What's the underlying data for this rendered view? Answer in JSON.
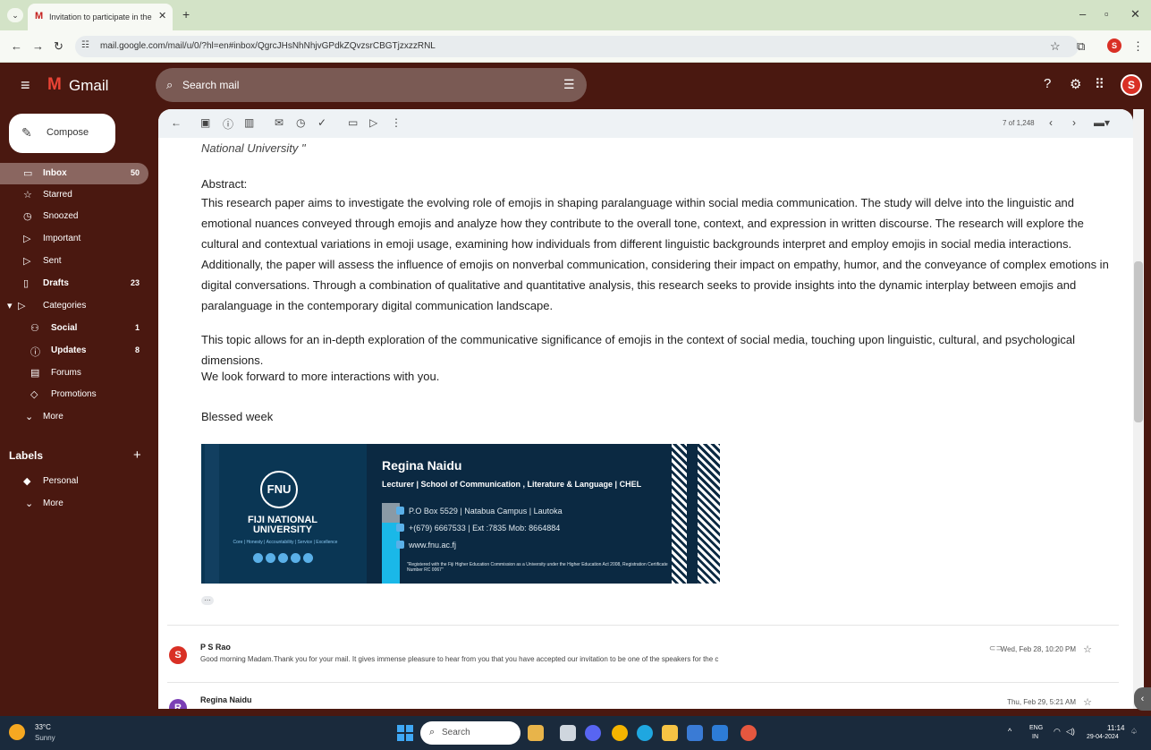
{
  "browser": {
    "tab_title": "Invitation to participate in the",
    "url": "mail.google.com/mail/u/0/?hl=en#inbox/QgrcJHsNhNhjvGPdkZQvzsrCBGTjzxzzRNL"
  },
  "gmail": {
    "app_name": "Gmail",
    "search_placeholder": "Search mail",
    "compose_label": "Compose",
    "nav": [
      {
        "label": "Inbox",
        "count": "50",
        "icon": "inbox-icon"
      },
      {
        "label": "Starred",
        "count": "",
        "icon": "star-icon"
      },
      {
        "label": "Snoozed",
        "count": "",
        "icon": "clock-icon"
      },
      {
        "label": "Important",
        "count": "",
        "icon": "important-icon"
      },
      {
        "label": "Sent",
        "count": "",
        "icon": "send-icon"
      },
      {
        "label": "Drafts",
        "count": "23",
        "icon": "draft-icon"
      },
      {
        "label": "Categories",
        "count": "",
        "icon": "label-icon"
      },
      {
        "label": "Social",
        "count": "1",
        "icon": "people-icon"
      },
      {
        "label": "Updates",
        "count": "8",
        "icon": "info-icon"
      },
      {
        "label": "Forums",
        "count": "",
        "icon": "forum-icon"
      },
      {
        "label": "Promotions",
        "count": "",
        "icon": "tag-icon"
      },
      {
        "label": "More",
        "count": "",
        "icon": "chevron-down-icon"
      }
    ],
    "labels_heading": "Labels",
    "labels": [
      {
        "label": "Personal"
      },
      {
        "label": "More"
      }
    ],
    "pager": "7 of 1,248"
  },
  "email": {
    "affiliation_line": "National University \"",
    "abstract_heading": "Abstract:",
    "abstract_body": "This research paper aims to investigate the evolving role of emojis in shaping paralanguage within social media communication. The study will delve into the linguistic and emotional nuances conveyed through emojis and analyze how they contribute to the overall tone, context, and expression in written discourse. The research will explore the cultural and contextual variations in emoji usage, examining how individuals from different linguistic backgrounds interpret and employ emojis in social media interactions. Additionally, the paper will assess the influence of emojis on nonverbal communication, considering their impact on empathy, humor, and the conveyance of complex emotions in digital conversations. Through a combination of qualitative and quantitative analysis, this research seeks to provide insights into the dynamic interplay between emojis and paralanguage in the contemporary digital communication landscape.",
    "topic_para": "This topic allows for an in-depth exploration of the communicative significance of emojis in the context of social media, touching upon linguistic, cultural, and psychological dimensions.",
    "closing_1": "We look forward to more interactions with you.",
    "closing_2": "Blessed week",
    "signature": {
      "logo_text": "FNU",
      "university": "FIJI NATIONAL UNIVERSITY",
      "values": "Core | Honesty | Accountability | Service | Excellence",
      "name": "Regina Naidu",
      "role": "Lecturer  |  School of Communication , Literature & Language | CHEL",
      "address": "P.O Box 5529 | Natabua Campus | Lautoka",
      "phone": "+(679) 6667533 | Ext :7835  Mob: 8664884",
      "web": "www.fnu.ac.fj",
      "registration": "\"Registered with the Fiji Higher Education Commission as a University under the Higher Education Act 2008, Registration Certificate Number RC 0067\""
    },
    "thread": [
      {
        "sender": "P S Rao",
        "avatar": "S",
        "snippet": "Good morning Madam.Thank you for your mail. It gives immense pleasure to hear from you that you have accepted our invitation to be one of the speakers for the c",
        "date": "Wed, Feb 28, 10:20 PM"
      },
      {
        "sender": "Regina Naidu",
        "avatar": "R",
        "snippet": "",
        "date": "Thu, Feb 29, 5:21 AM"
      }
    ]
  },
  "taskbar": {
    "temperature": "33°C",
    "weather": "Sunny",
    "search_label": "Search",
    "language_top": "ENG",
    "language_bottom": "IN",
    "time": "11:14",
    "date": "29-04-2024"
  },
  "colors": {
    "theme_background": "#4a1810",
    "accent_red": "#d93025"
  }
}
